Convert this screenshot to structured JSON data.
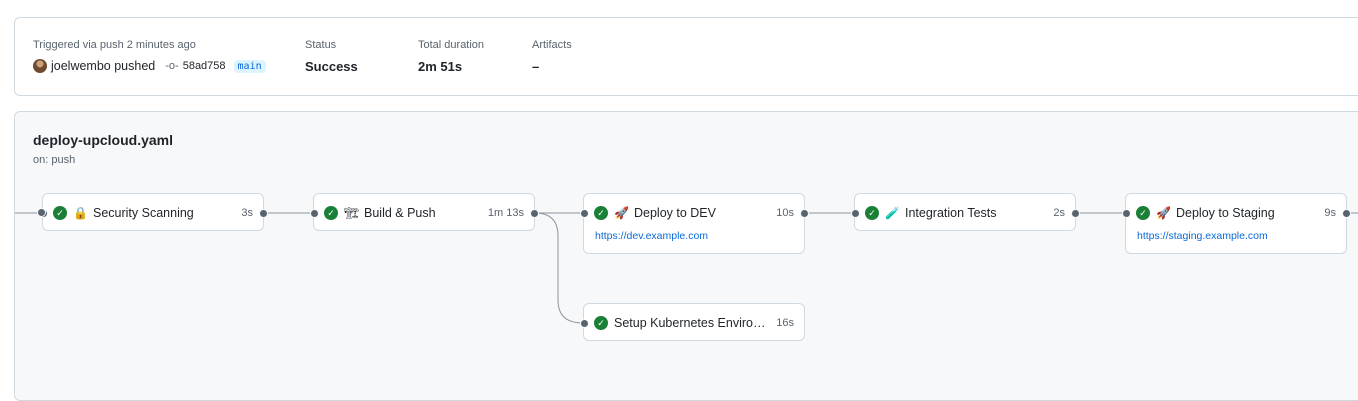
{
  "summary": {
    "trigger_label": "Triggered via push 2 minutes ago",
    "actor": "joelwembo pushed",
    "commit_sha": "58ad758",
    "branch": "main",
    "status_label": "Status",
    "status_value": "Success",
    "duration_label": "Total duration",
    "duration_value": "2m 51s",
    "artifacts_label": "Artifacts",
    "artifacts_value": "–"
  },
  "workflow": {
    "file": "deploy-upcloud.yaml",
    "trigger": "on: push"
  },
  "jobs": [
    {
      "name": "Security Scanning",
      "emoji": "🔒",
      "duration": "3s",
      "status": "success"
    },
    {
      "name": "Build & Push",
      "emoji": "🏗",
      "duration": "1m 13s",
      "status": "success"
    },
    {
      "name": "Deploy to DEV",
      "emoji": "🚀",
      "duration": "10s",
      "status": "success",
      "url": "https://dev.example.com"
    },
    {
      "name": "Setup Kubernetes Environm...",
      "emoji": "",
      "duration": "16s",
      "status": "success"
    },
    {
      "name": "Integration Tests",
      "emoji": "🧪",
      "duration": "2s",
      "status": "success"
    },
    {
      "name": "Deploy to Staging",
      "emoji": "🚀",
      "duration": "9s",
      "status": "success",
      "url": "https://staging.example.com"
    }
  ],
  "colors": {
    "success": "#1a7f37",
    "link": "#0969da",
    "muted": "#59636e"
  }
}
